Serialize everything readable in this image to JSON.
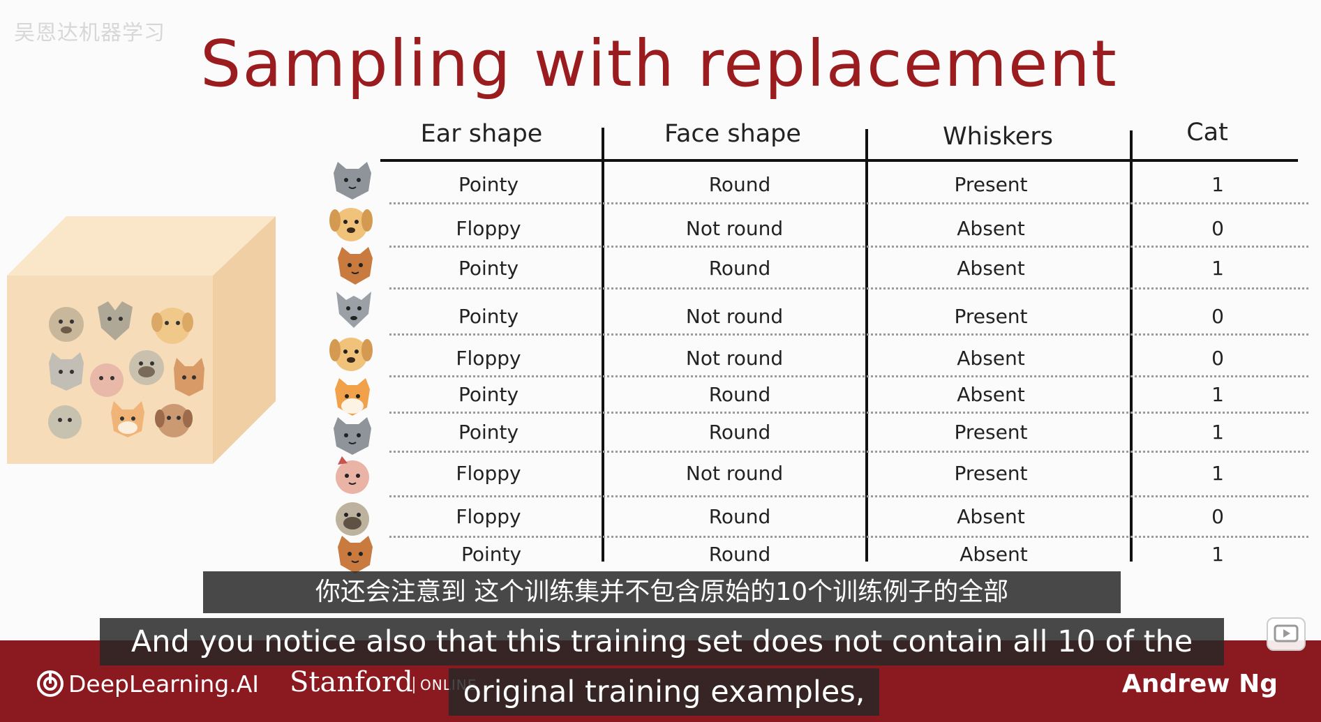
{
  "watermark": "吴恩达机器学习",
  "slide": {
    "title": "Sampling with replacement"
  },
  "table": {
    "headers": [
      "Ear shape",
      "Face shape",
      "Whiskers",
      "Cat"
    ],
    "rows": [
      {
        "icon": "gray-cat-icon",
        "ear": "Pointy",
        "face": "Round",
        "whiskers": "Present",
        "cat": "1"
      },
      {
        "icon": "yellow-dog-icon",
        "ear": "Floppy",
        "face": "Not round",
        "whiskers": "Absent",
        "cat": "0"
      },
      {
        "icon": "orange-cat-icon",
        "ear": "Pointy",
        "face": "Round",
        "whiskers": "Absent",
        "cat": "1"
      },
      {
        "icon": "gray-wolf-icon",
        "ear": "Pointy",
        "face": "Not round",
        "whiskers": "Present",
        "cat": "0"
      },
      {
        "icon": "yellow-dog-icon",
        "ear": "Floppy",
        "face": "Not round",
        "whiskers": "Absent",
        "cat": "0"
      },
      {
        "icon": "orange-white-cat-icon",
        "ear": "Pointy",
        "face": "Round",
        "whiskers": "Absent",
        "cat": "1"
      },
      {
        "icon": "gray-cat-icon",
        "ear": "Pointy",
        "face": "Round",
        "whiskers": "Present",
        "cat": "1"
      },
      {
        "icon": "pink-cat-icon",
        "ear": "Floppy",
        "face": "Not round",
        "whiskers": "Present",
        "cat": "1"
      },
      {
        "icon": "pug-dog-icon",
        "ear": "Floppy",
        "face": "Round",
        "whiskers": "Absent",
        "cat": "0"
      },
      {
        "icon": "orange-cat-icon",
        "ear": "Pointy",
        "face": "Round",
        "whiskers": "Absent",
        "cat": "1"
      }
    ]
  },
  "subtitles": {
    "chinese": "你还会注意到 这个训练集并不包含原始的10个训练例子的全部",
    "english_line1": "And you notice also that this training set does not contain all 10 of the",
    "english_line2": "original training examples,"
  },
  "footer": {
    "deeplearning": "DeepLearning.AI",
    "stanford": "Stanford",
    "stanford_online": "ONLINE",
    "presenter": "Andrew Ng"
  },
  "colors": {
    "title": "#9b1c1f",
    "footer_bar": "#8a1a1f",
    "cube_front": "#f6dcb8",
    "cube_top": "#fae6c9",
    "cube_side": "#f0cfa4"
  }
}
